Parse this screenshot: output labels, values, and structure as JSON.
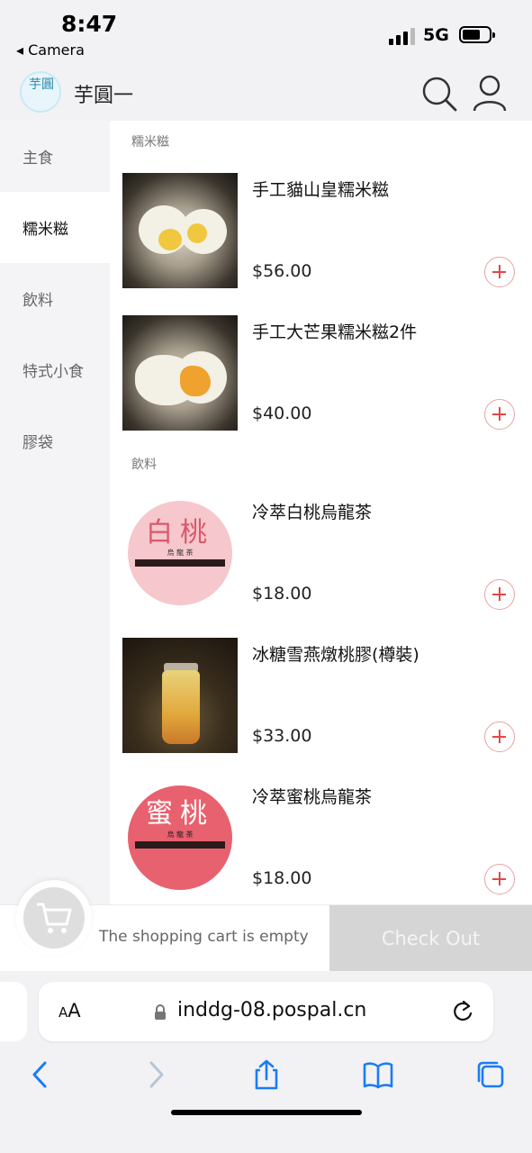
{
  "status_bar": {
    "time": "8:47",
    "back_app": "◂ Camera",
    "network": "5G"
  },
  "header": {
    "logo_text": "芋圓",
    "shop_name": "芋圓一"
  },
  "sidebar": {
    "items": [
      {
        "label": "主食"
      },
      {
        "label": "糯米糍"
      },
      {
        "label": "飲料"
      },
      {
        "label": "特式小食"
      },
      {
        "label": "膠袋"
      }
    ],
    "active_index": 1
  },
  "sections": [
    {
      "title": "糯米糍",
      "products": [
        {
          "name": "手工貓山皇糯米糍",
          "price": "$56.00",
          "image": "durian-mochi"
        },
        {
          "name": "手工大芒果糯米糍2件",
          "price": "$40.00",
          "image": "mango-mochi"
        }
      ]
    },
    {
      "title": "飲料",
      "products": [
        {
          "name": "冷萃白桃烏龍茶",
          "price": "$18.00",
          "image": "white-peach-label",
          "label_cn": "白桃",
          "label_sub": "烏 龍 茶"
        },
        {
          "name": "冰糖雪燕燉桃膠(樽裝)",
          "price": "$33.00",
          "image": "peach-gum-jar"
        },
        {
          "name": "冷萃蜜桃烏龍茶",
          "price": "$18.00",
          "image": "honey-peach-label",
          "label_cn": "蜜桃",
          "label_sub": "烏 龍 茶"
        }
      ]
    }
  ],
  "cart": {
    "empty_text": "The shopping cart is empty",
    "checkout_label": "Check Out"
  },
  "browser": {
    "aa_label_small": "A",
    "aa_label_big": "A",
    "url": "inddg-08.pospal.cn"
  },
  "colors": {
    "accent_red": "#e04848",
    "sidebar_bg": "#f4f4f6",
    "checkout_bg": "#d5d5d5",
    "ios_blue": "#1a7cf5"
  }
}
